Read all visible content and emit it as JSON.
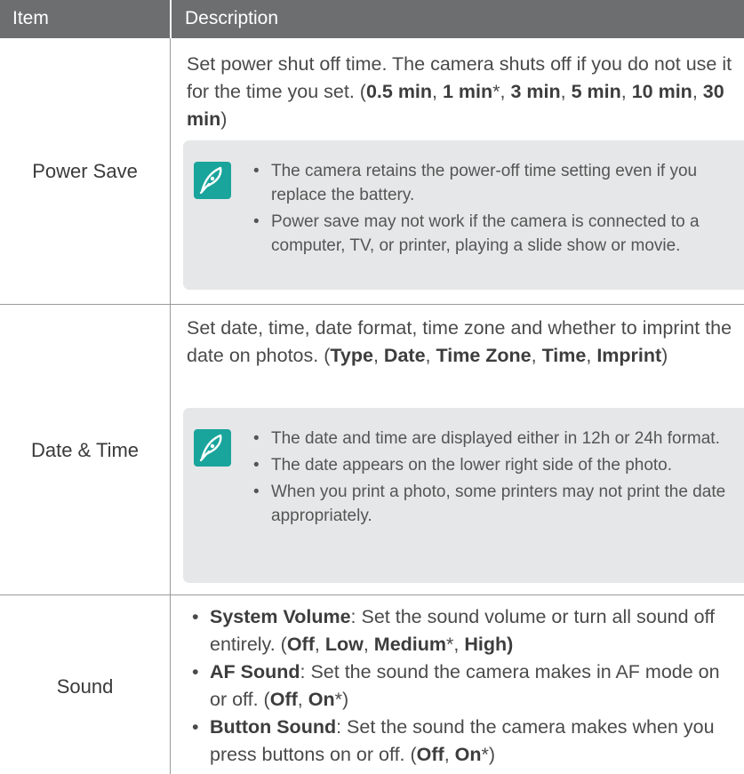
{
  "header": {
    "item": "Item",
    "description": "Description"
  },
  "rows": {
    "power_save": {
      "label": "Power Save",
      "desc_text": "Set power shut off time. The camera shuts off if you do not use it for the time you set. (",
      "options": [
        "0.5 min",
        "1 min",
        "3 min",
        "5 min",
        "10 min",
        "30 min"
      ],
      "default_marker": "*",
      "notes": [
        "The camera retains the power-off time setting even if you replace the battery.",
        "Power save may not work if the camera is connected to a computer, TV, or printer, playing a slide show or movie."
      ]
    },
    "date_time": {
      "label": "Date & Time",
      "desc_text": "Set date, time, date format, time zone and whether to imprint the date on photos. (",
      "options": [
        "Type",
        "Date",
        "Time Zone",
        "Time",
        "Imprint"
      ],
      "notes": [
        "The date and time are displayed either in 12h or 24h format.",
        "The date appears on the lower right side of the photo.",
        "When you print a photo, some printers may not print the date appropriately."
      ]
    },
    "sound": {
      "label": "Sound",
      "items": [
        {
          "name": "System Volume",
          "text": ": Set the sound volume or turn all sound off entirely. (",
          "options": [
            "Off",
            "Low",
            "Medium",
            "High"
          ],
          "default_index": 2
        },
        {
          "name": "AF Sound",
          "text": ": Set the sound the camera makes in AF mode on or off. (",
          "options": [
            "Off",
            "On"
          ],
          "default_index": 1
        },
        {
          "name": "Button Sound",
          "text": ": Set the sound the camera makes when you press buttons on or off. (",
          "options": [
            "Off",
            "On"
          ],
          "default_index": 1
        }
      ]
    }
  },
  "colors": {
    "header_bg": "#6d6e70",
    "note_bg": "#e6e7e8",
    "note_icon": "#19a49c"
  },
  "icons": {
    "note": "pen-nib-icon"
  }
}
